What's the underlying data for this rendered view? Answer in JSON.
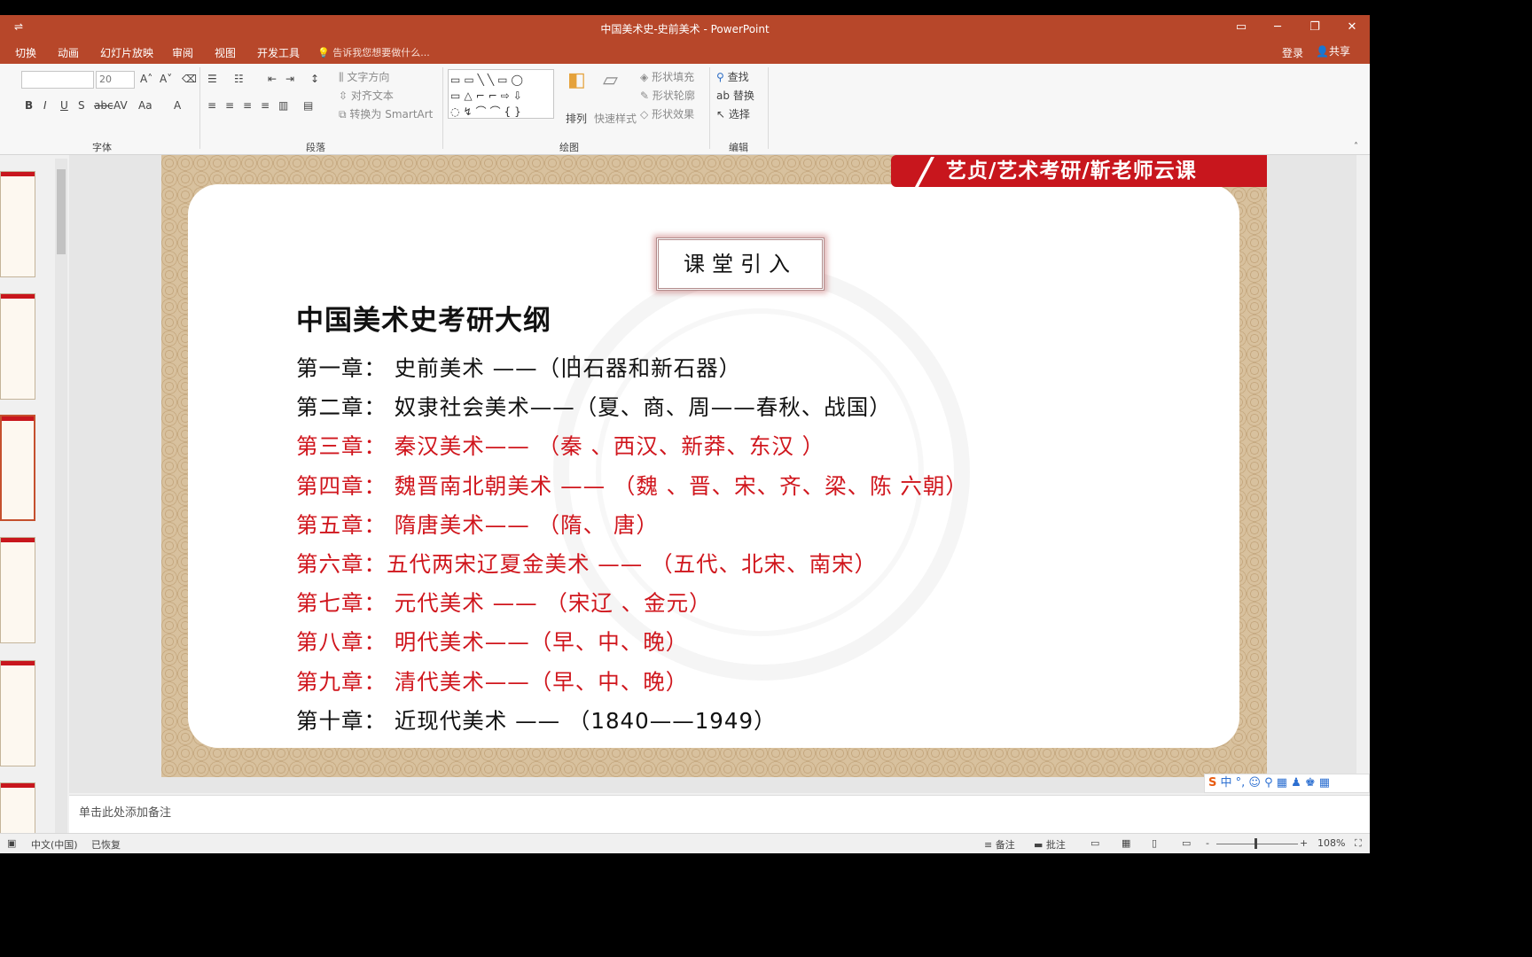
{
  "window": {
    "title": "中国美术史-史前美术 - PowerPoint",
    "qat_label": "⇌"
  },
  "tabs": [
    "切换",
    "动画",
    "幻灯片放映",
    "审阅",
    "视图",
    "开发工具"
  ],
  "tell_me": "告诉我您想要做什么...",
  "account": {
    "login": "登录",
    "share": "共享"
  },
  "ribbon": {
    "font_size": "20",
    "groups": {
      "font": "字体",
      "paragraph": "段落",
      "drawing": "绘图",
      "editing": "编辑"
    },
    "paragraph_btns": {
      "text_direction": "文字方向",
      "align_text": "对齐文本",
      "smartart": "转换为 SmartArt"
    },
    "drawing_btns": {
      "arrange": "排列",
      "quick_styles": "快速样式",
      "shape_fill": "形状填充",
      "shape_outline": "形状轮廓",
      "shape_effects": "形状效果"
    },
    "editing_btns": {
      "find": "查找",
      "replace": "替换",
      "select": "选择"
    },
    "shape_glyphs": "▭▭╲╲▭◯ ▭△⌐⌐⇨⇩ ◌↯⌒⌒{}"
  },
  "slide": {
    "banner": "艺贞/艺术考研/靳老师云课",
    "tag": "课堂引入",
    "heading": "中国美术史考研大纲",
    "lines": [
      "第一章：  史前美术 ——（旧石器和新石器）",
      "第二章：  奴隶社会美术——（夏、商、周——春秋、战国）",
      "第三章：  秦汉美术——       （秦 、西汉、新莽、东汉 ）",
      "第四章：  魏晋南北朝美术   ——   （魏 、晋、宋、齐、梁、陈   六朝）",
      "第五章：  隋唐美术——   （隋、 唐）",
      "第六章：五代两宋辽夏金美术   ——  （五代、北宋、南宋）",
      "第七章：  元代美术   ——   （宋辽 、金元）",
      "第八章：  明代美术——（早、中、晚）",
      "第九章：  清代美术——（早、中、晚）",
      "第十章：  近现代美术   ——  （1840——1949）"
    ],
    "line_colors": [
      "black",
      "black",
      "red",
      "red",
      "red",
      "red",
      "red",
      "red",
      "red",
      "black"
    ]
  },
  "ime_bar": "中 °, ☺ ⚲ ▦ ♟ ♚ ▦",
  "notes_placeholder": "单击此处添加备注",
  "status": {
    "language": "中文(中国)",
    "recovered": "已恢复",
    "notes_btn": "备注",
    "comments_btn": "批注",
    "zoom": "108%"
  }
}
